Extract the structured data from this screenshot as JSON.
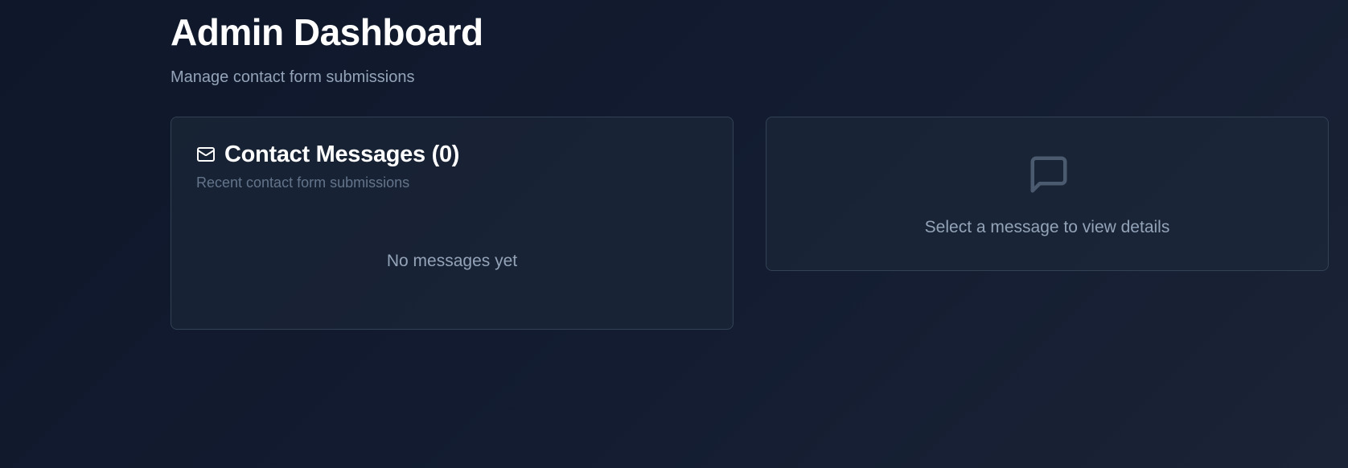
{
  "header": {
    "title": "Admin Dashboard",
    "subtitle": "Manage contact form submissions"
  },
  "messages_panel": {
    "icon": "mail-icon",
    "title": "Contact Messages (0)",
    "description": "Recent contact form submissions",
    "empty_state": "No messages yet"
  },
  "details_panel": {
    "icon": "message-square-icon",
    "placeholder": "Select a message to view details"
  },
  "colors": {
    "background": "#0f172a",
    "card_border": "#334155",
    "muted_text": "#94a3b8",
    "subtle_text": "#64748b",
    "icon_muted": "#4b5a6e"
  }
}
